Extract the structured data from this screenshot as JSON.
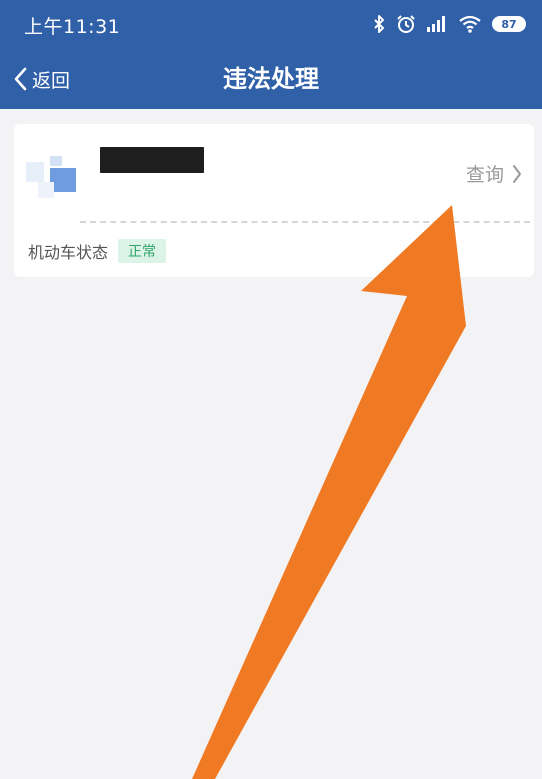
{
  "status_bar": {
    "time": "上午11:31",
    "battery": "87"
  },
  "nav": {
    "back_label": "返回",
    "title": "违法处理"
  },
  "vehicle_card": {
    "query_label": "查询",
    "status_label": "机动车状态",
    "status_value": "正常"
  },
  "colors": {
    "primary": "#2f60a8",
    "background": "#f3f3f6",
    "badge_text": "#2fa46a",
    "badge_bg": "#dcf3e7",
    "annotation_arrow": "#f07a23"
  }
}
